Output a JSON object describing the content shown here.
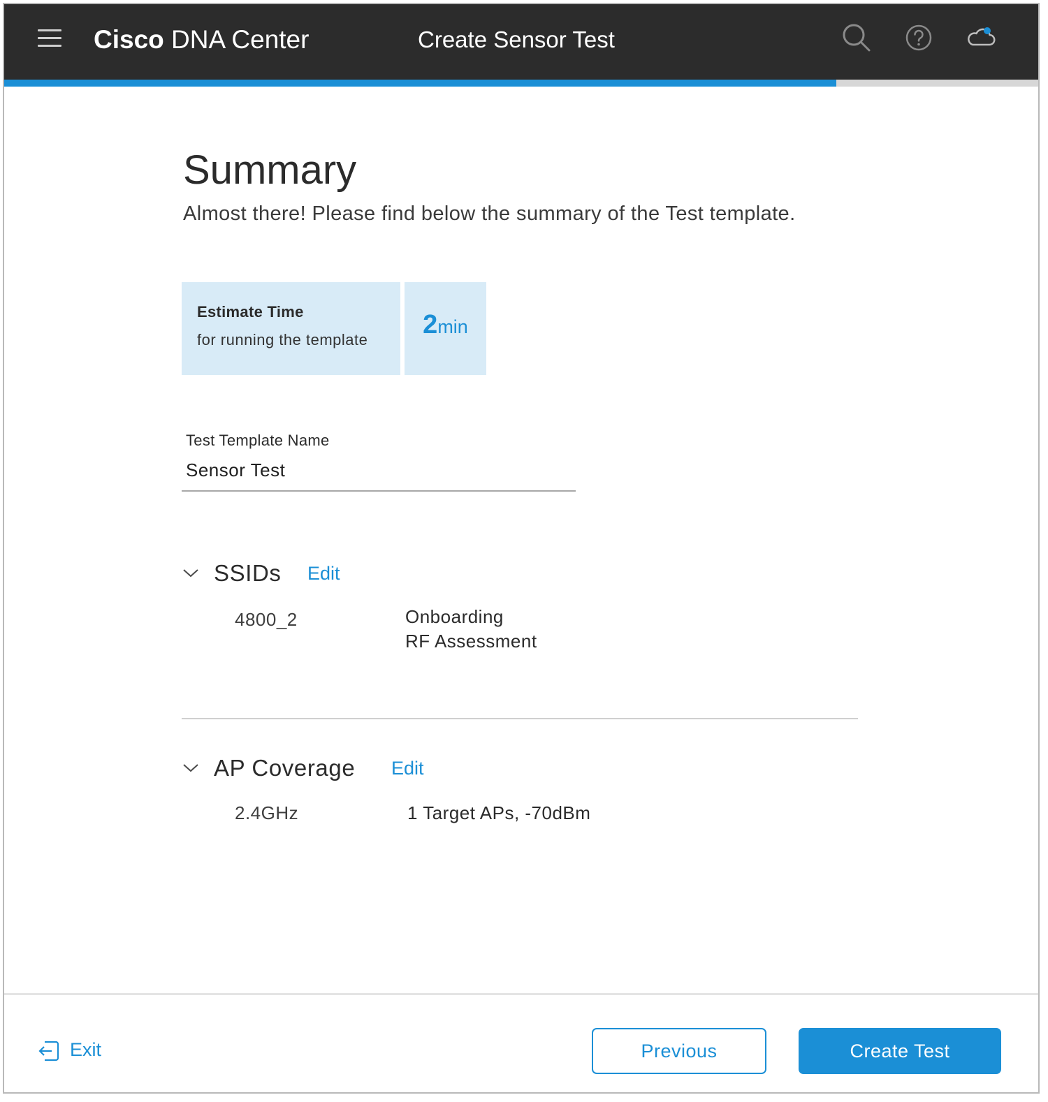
{
  "header": {
    "brand_bold": "Cisco",
    "brand_rest": "DNA Center",
    "page_heading": "Create Sensor Test",
    "progress_fraction": 0.805,
    "icons": [
      "menu-icon",
      "search-icon",
      "help-icon",
      "cloud-notification-icon"
    ]
  },
  "summary": {
    "title": "Summary",
    "subtitle": "Almost there! Please find below the summary of the Test template."
  },
  "estimate": {
    "title": "Estimate Time",
    "description": "for running the template",
    "value": "2",
    "unit": "min"
  },
  "template_name": {
    "label": "Test Template Name",
    "value": "Sensor Test"
  },
  "ssids": {
    "title": "SSIDs",
    "edit_label": "Edit",
    "rows": [
      {
        "name": "4800_2",
        "tests": [
          "Onboarding",
          "RF Assessment"
        ]
      }
    ]
  },
  "ap_coverage": {
    "title": "AP Coverage",
    "edit_label": "Edit",
    "rows": [
      {
        "band": "2.4GHz",
        "detail": "1 Target APs, -70dBm"
      }
    ]
  },
  "footer": {
    "exit_label": "Exit",
    "previous_label": "Previous",
    "create_label": "Create Test"
  },
  "colors": {
    "accent": "#1b8fd6",
    "header_bg": "#2c2c2c",
    "info_box_bg": "#d8ebf7"
  }
}
